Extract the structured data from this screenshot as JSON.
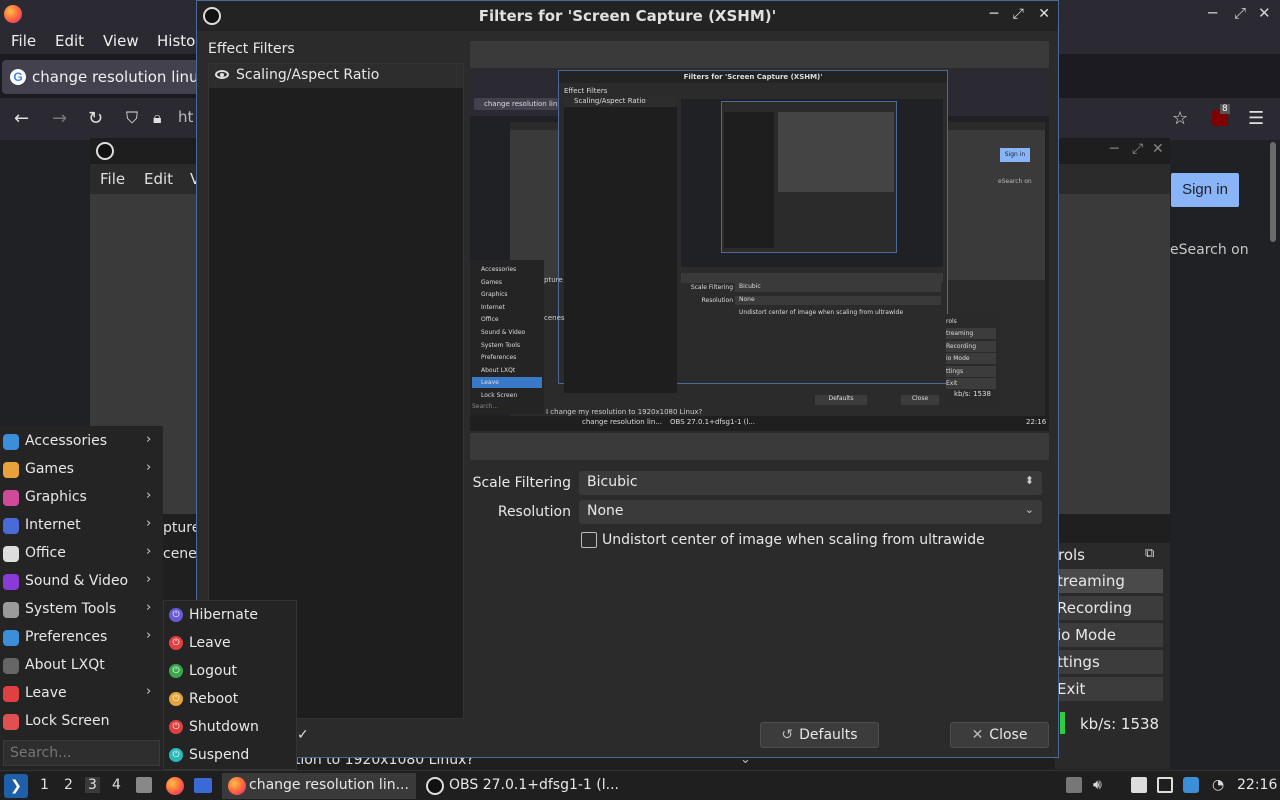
{
  "firefox": {
    "menu": [
      "File",
      "Edit",
      "View",
      "Histor"
    ],
    "tab_title": "change resolution linux",
    "url_partial": "ht",
    "ublock_badge": "8",
    "sign_in": "Sign in",
    "search_on": "eSearch on"
  },
  "obs_main": {
    "menu": [
      "File",
      "Edit",
      "V"
    ],
    "capture_fragments": [
      "pture",
      "cenes"
    ],
    "controls_header": "rols",
    "controls": [
      "treaming",
      "Recording",
      "io Mode",
      "ttings",
      "Exit"
    ],
    "kbs": "kb/s: 1538",
    "behind_text": "ution to 1920x1080 Linux?"
  },
  "dialog": {
    "title": "Filters for 'Screen Capture (XSHM)'",
    "effect_filters_label": "Effect Filters",
    "filters": [
      "Scaling/Aspect Ratio"
    ],
    "scale_filtering_label": "Scale Filtering",
    "scale_filtering_value": "Bicubic",
    "resolution_label": "Resolution",
    "resolution_value": "None",
    "undistort_label": "Undistort center of image when scaling from ultrawide",
    "defaults_button": "Defaults",
    "close_button": "Close",
    "tools": [
      "+",
      "−",
      "⌃",
      "⌄"
    ]
  },
  "lxqt_menu": {
    "items": [
      {
        "label": "Accessories",
        "icon": "accessories-icon",
        "color": "#3a8fd8",
        "submenu": true
      },
      {
        "label": "Games",
        "icon": "games-icon",
        "color": "#e8a23a",
        "submenu": true
      },
      {
        "label": "Graphics",
        "icon": "graphics-icon",
        "color": "#d04a9a",
        "submenu": true
      },
      {
        "label": "Internet",
        "icon": "internet-icon",
        "color": "#4a6ad8",
        "submenu": true
      },
      {
        "label": "Office",
        "icon": "office-icon",
        "color": "#dddddd",
        "submenu": true
      },
      {
        "label": "Sound & Video",
        "icon": "sound-video-icon",
        "color": "#8a3ad8",
        "submenu": true
      },
      {
        "label": "System Tools",
        "icon": "system-tools-icon",
        "color": "#9a9a9a",
        "submenu": true
      },
      {
        "label": "Preferences",
        "icon": "preferences-icon",
        "color": "#3a8fd8",
        "submenu": true
      },
      {
        "label": "About LXQt",
        "icon": "info-icon",
        "color": "#666666",
        "submenu": false
      },
      {
        "label": "Leave",
        "icon": "leave-icon",
        "color": "#e04040",
        "submenu": true
      },
      {
        "label": "Lock Screen",
        "icon": "lock-icon",
        "color": "#e05050",
        "submenu": false
      }
    ],
    "search_placeholder": "Search...",
    "leave_submenu": [
      {
        "label": "Hibernate",
        "icon": "hibernate-icon",
        "color": "#6a5ad8"
      },
      {
        "label": "Leave",
        "icon": "leave-icon",
        "color": "#e04040"
      },
      {
        "label": "Logout",
        "icon": "logout-icon",
        "color": "#3aa84a"
      },
      {
        "label": "Reboot",
        "icon": "reboot-icon",
        "color": "#e8a23a"
      },
      {
        "label": "Shutdown",
        "icon": "shutdown-icon",
        "color": "#e04040"
      },
      {
        "label": "Suspend",
        "icon": "suspend-icon",
        "color": "#2ab8b8"
      }
    ]
  },
  "taskbar": {
    "desktops": [
      "1",
      "2",
      "3",
      "4"
    ],
    "active_desktop": "3",
    "tasks": [
      "change resolution lin...",
      "OBS 27.0.1+dfsg1-1 (l..."
    ],
    "clock": "22:16"
  },
  "preview": {
    "title": "Filters for 'Screen Capture (XSHM)'",
    "effect_filters_label": "Effect Filters",
    "filter": "Scaling/Aspect Ratio",
    "scale_filtering_label": "Scale Filtering",
    "scale_filtering_value": "Bicubic",
    "resolution_label": "Resolution",
    "resolution_value": "None",
    "undistort_label": "Undistort center of image when scaling from ultrawide",
    "defaults": "Defaults",
    "close": "Close",
    "tab": "change resolution lin",
    "menu_items": [
      "Accessories",
      "Games",
      "Graphics",
      "Internet",
      "Office",
      "Sound & Video",
      "System Tools",
      "Preferences",
      "About LXQt",
      "Leave",
      "Lock Screen"
    ],
    "search": "Search...",
    "sign_in": "Sign in",
    "search_on": "eSearch on",
    "controls": [
      "rols",
      "treaming",
      "Recording",
      "io Mode",
      "ttings",
      "Exit"
    ],
    "kbs": "kb/s: 1538",
    "task_firefox": "change resolution lin...",
    "task_obs": "OBS 27.0.1+dfsg1-1 (l...",
    "clock": "22:16",
    "question": "I change my resolution to 1920x1080 Linux?",
    "capture_fragments": [
      "pture",
      "cenes"
    ]
  }
}
